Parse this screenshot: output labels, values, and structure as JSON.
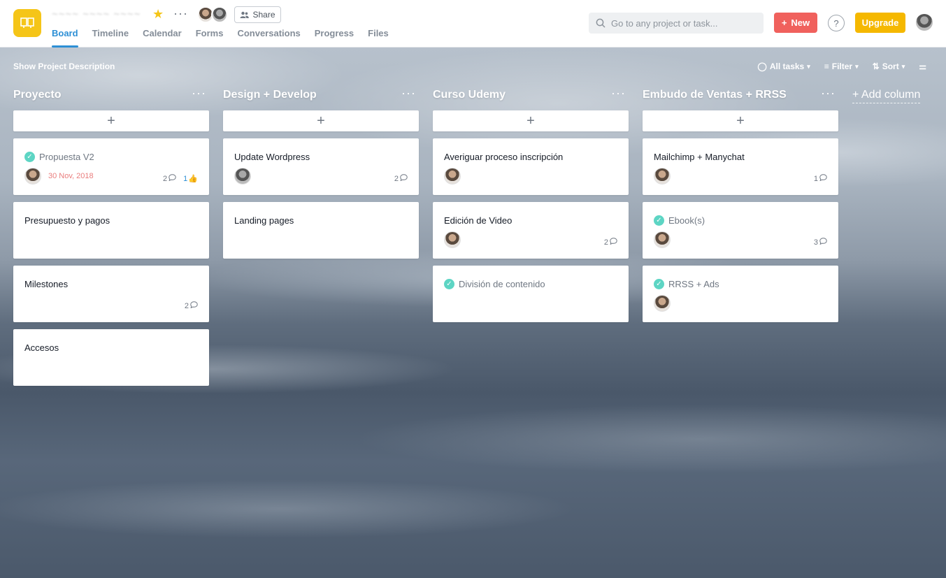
{
  "header": {
    "project_title": "~~~~ ~~~~ ~~~~",
    "share_label": "Share",
    "tabs": [
      {
        "label": "Board",
        "active": true
      },
      {
        "label": "Timeline",
        "active": false
      },
      {
        "label": "Calendar",
        "active": false
      },
      {
        "label": "Forms",
        "active": false
      },
      {
        "label": "Conversations",
        "active": false
      },
      {
        "label": "Progress",
        "active": false
      },
      {
        "label": "Files",
        "active": false
      }
    ],
    "search_placeholder": "Go to any project or task...",
    "new_label": "New",
    "help_label": "?",
    "upgrade_label": "Upgrade"
  },
  "toolbar": {
    "show_description": "Show Project Description",
    "all_tasks": "All tasks",
    "filter": "Filter",
    "sort": "Sort"
  },
  "columns": [
    {
      "title": "Proyecto",
      "cards": [
        {
          "title": "Propuesta V2",
          "done": true,
          "assignee": "user",
          "due": "30 Nov, 2018",
          "comments": "2",
          "likes": "1"
        },
        {
          "title": "Presupuesto y pagos",
          "done": false
        },
        {
          "title": "Milestones",
          "done": false,
          "comments": "2"
        },
        {
          "title": "Accesos",
          "done": false
        }
      ]
    },
    {
      "title": "Design + Develop",
      "cards": [
        {
          "title": "Update Wordpress",
          "done": false,
          "assignee": "gray",
          "comments": "2"
        },
        {
          "title": "Landing pages",
          "done": false
        }
      ]
    },
    {
      "title": "Curso Udemy",
      "cards": [
        {
          "title": "Averiguar proceso inscripción",
          "done": false,
          "assignee": "user"
        },
        {
          "title": "Edición de Video",
          "done": false,
          "assignee": "user",
          "comments": "2"
        },
        {
          "title": "División de contenido",
          "done": true
        }
      ]
    },
    {
      "title": "Embudo de Ventas + RRSS",
      "cards": [
        {
          "title": "Mailchimp + Manychat",
          "done": false,
          "assignee": "user",
          "comments": "1"
        },
        {
          "title": "Ebook(s)",
          "done": true,
          "assignee": "user",
          "comments": "3"
        },
        {
          "title": "RRSS + Ads",
          "done": true,
          "assignee": "user"
        }
      ]
    }
  ],
  "add_column_label": "+ Add column",
  "colors": {
    "accent": "#2d8fd5",
    "new": "#f0615d",
    "upgrade": "#f5b800",
    "project_icon": "#f5c518",
    "done_check": "#5dd5c4",
    "due_overdue": "#ea7d7d"
  }
}
